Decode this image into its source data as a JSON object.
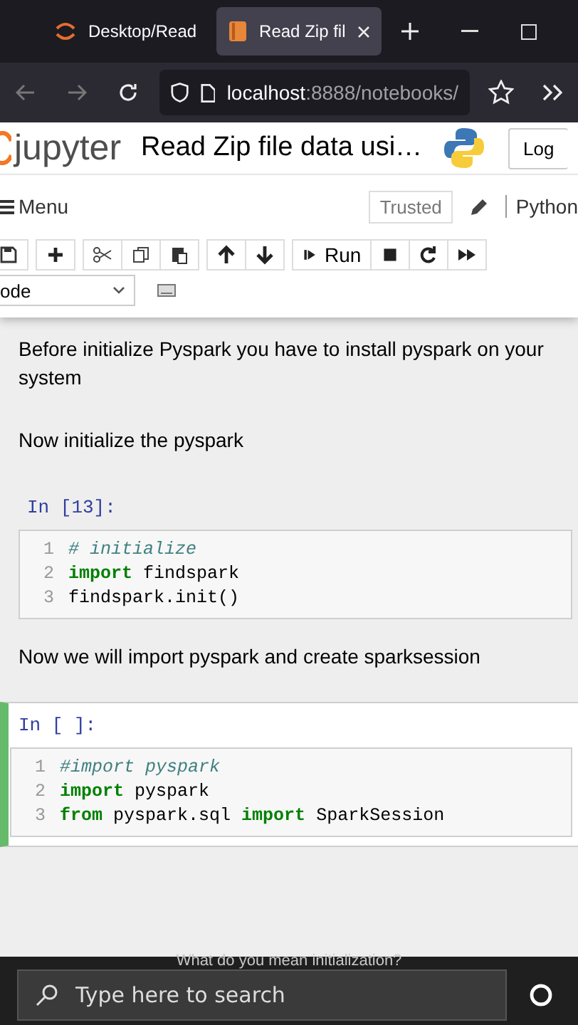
{
  "browser": {
    "tabs": [
      {
        "title": "Desktop/Read",
        "selected": false
      },
      {
        "title": "Read Zip fil",
        "selected": true
      }
    ],
    "url": {
      "host": "localhost",
      "path": ":8888/notebooks/"
    }
  },
  "header": {
    "logo_text": "jupyter",
    "notebook_title": "Read Zip file data usi…",
    "logout": "Log"
  },
  "menubar": {
    "menu": "Menu",
    "trusted": "Trusted",
    "kernel": "Python"
  },
  "toolbar": {
    "run": "Run",
    "cell_type": "ode"
  },
  "cells": [
    {
      "kind": "markdown",
      "text": "Before initialize Pyspark you have to install pyspark on your system"
    },
    {
      "kind": "markdown",
      "text": "Now initialize the pyspark"
    },
    {
      "kind": "code",
      "prompt": "In [13]:",
      "selected": false,
      "lines": [
        {
          "number": "1",
          "tokens": [
            {
              "kind": "comment",
              "text": "# initialize"
            }
          ]
        },
        {
          "number": "2",
          "tokens": [
            {
              "kind": "keyword",
              "text": "import"
            },
            {
              "kind": "plain",
              "text": " findspark"
            }
          ]
        },
        {
          "number": "3",
          "tokens": [
            {
              "kind": "plain",
              "text": "findspark.init()"
            }
          ]
        }
      ]
    },
    {
      "kind": "markdown",
      "text": "Now we will import pyspark and create sparksession"
    },
    {
      "kind": "code",
      "prompt": "In [ ]:",
      "selected": true,
      "lines": [
        {
          "number": "1",
          "tokens": [
            {
              "kind": "comment",
              "text": "#import pyspark"
            }
          ]
        },
        {
          "number": "2",
          "tokens": [
            {
              "kind": "keyword",
              "text": "import"
            },
            {
              "kind": "plain",
              "text": " pyspark"
            }
          ]
        },
        {
          "number": "3",
          "tokens": [
            {
              "kind": "keyword",
              "text": "from"
            },
            {
              "kind": "plain",
              "text": " pyspark.sql "
            },
            {
              "kind": "keyword",
              "text": "import"
            },
            {
              "kind": "plain",
              "text": " SparkSession"
            }
          ]
        }
      ]
    }
  ],
  "caption": "What do you mean initialization?",
  "taskbar": {
    "search": {
      "placeholder": "Type here to search"
    }
  }
}
